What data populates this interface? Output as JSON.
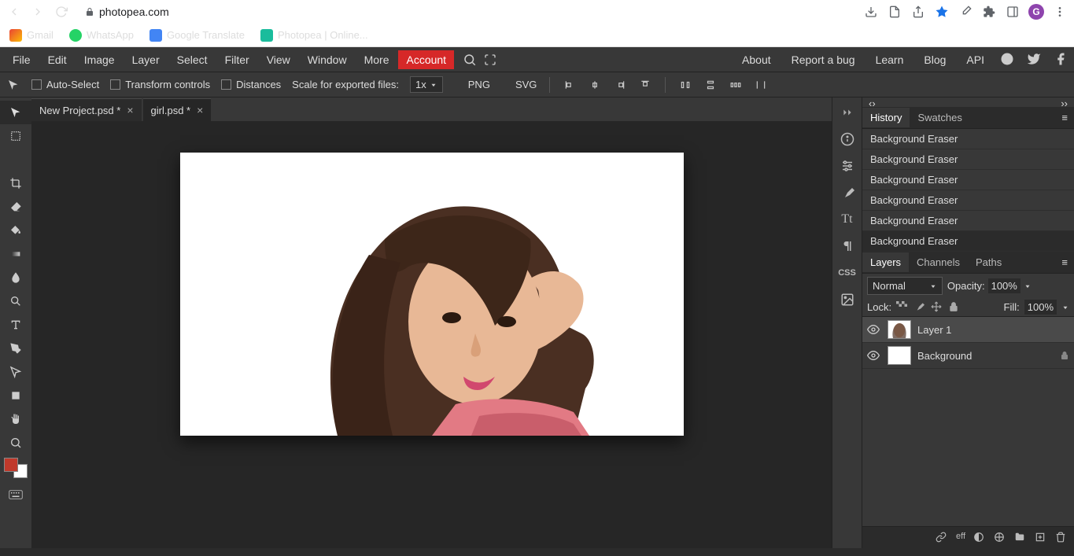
{
  "browser": {
    "url_host": "photopea.com",
    "bookmarks": [
      {
        "label": "Gmail",
        "color": "#ea4335"
      },
      {
        "label": "WhatsApp",
        "color": "#25d366"
      },
      {
        "label": "Google Translate",
        "color": "#4285f4"
      },
      {
        "label": "Photopea | Online...",
        "color": "#1abc9c"
      }
    ],
    "avatar_letter": "G"
  },
  "menubar": {
    "items": [
      "File",
      "Edit",
      "Image",
      "Layer",
      "Select",
      "Filter",
      "View",
      "Window",
      "More"
    ],
    "account": "Account",
    "right": [
      "About",
      "Report a bug",
      "Learn",
      "Blog",
      "API"
    ]
  },
  "options": {
    "auto_select": "Auto-Select",
    "transform": "Transform controls",
    "distances": "Distances",
    "scale_label": "Scale for exported files:",
    "scale_value": "1x",
    "png": "PNG",
    "svg": "SVG"
  },
  "tabs": [
    {
      "name": "New Project.psd *",
      "active": false
    },
    {
      "name": "girl.psd *",
      "active": true
    }
  ],
  "history": {
    "tab1": "History",
    "tab2": "Swatches",
    "items": [
      "Background Eraser",
      "Background Eraser",
      "Background Eraser",
      "Background Eraser",
      "Background Eraser",
      "Background Eraser"
    ]
  },
  "layers_panel": {
    "tab1": "Layers",
    "tab2": "Channels",
    "tab3": "Paths",
    "blend": "Normal",
    "opacity_label": "Opacity:",
    "opacity_value": "100%",
    "lock_label": "Lock:",
    "fill_label": "Fill:",
    "fill_value": "100%",
    "layers": [
      {
        "name": "Layer 1",
        "selected": true,
        "locked": false
      },
      {
        "name": "Background",
        "selected": false,
        "locked": true
      }
    ],
    "footer_eff": "eff"
  }
}
